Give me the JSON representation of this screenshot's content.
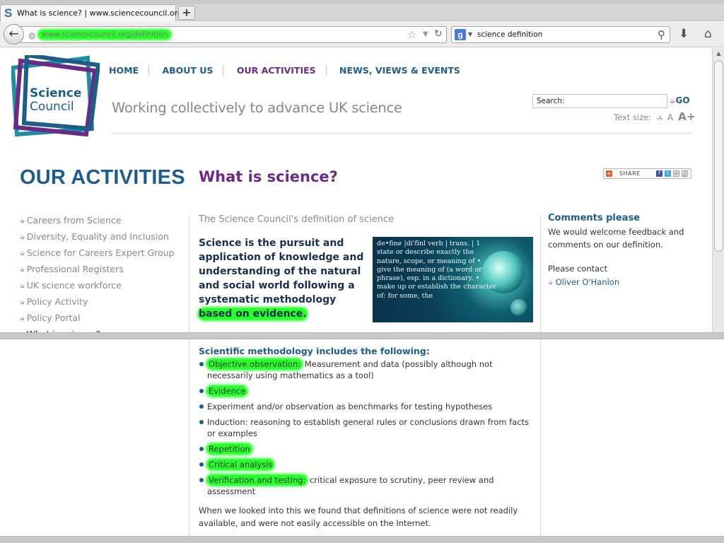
{
  "browser": {
    "tab_title": "What is science? | www.sciencecouncil.org",
    "tab_favicon": "S",
    "new_tab_label": "+",
    "url": "www.sciencecouncil.org/definition",
    "search_query": "science definition",
    "search_engine_letter": "g"
  },
  "site": {
    "logo_line1": "Science",
    "logo_line2": "Council",
    "tagline": "Working collectively to advance UK science",
    "nav": [
      "HOME",
      "ABOUT US",
      "OUR ACTIVITIES",
      "NEWS, VIEWS & EVENTS"
    ],
    "search_value": "Search:",
    "search_go": "GO",
    "text_size_label": "Text size:",
    "text_size_options": [
      "-A",
      "A",
      "A+"
    ],
    "colors": {
      "brand_blue": "#1e5c8a",
      "brand_purple": "#6b2a86",
      "highlight": "#27ff2b"
    }
  },
  "page": {
    "section_title": "OUR ACTIVITIES",
    "title": "What is science?",
    "share_label": "SHARE",
    "subhead": "The Science Council's definition of science",
    "definition": {
      "part1": "Science is the pursuit and application of knowledge and understanding of the natural and social world following a systematic methodology ",
      "highlighted": "based on evidence."
    },
    "dictionary_image_text": "de•fine |di'fīnl verb | trans. | 1 state or describe exactly the nature, scope, or meaning of • give the meaning of (a word or phrase), esp. in a dictionary. • make up or establish the character of: for some, the",
    "methodology_heading": "Scientific methodology includes the following:",
    "methodology": [
      {
        "term": "Objective observation:",
        "desc": " Measurement and data (possibly although not necessarily using mathematics as a tool)",
        "highlight": true
      },
      {
        "term": "Evidence",
        "desc": "",
        "highlight": true
      },
      {
        "term": "",
        "desc": "Experiment and/or observation as benchmarks for testing hypotheses",
        "highlight": false
      },
      {
        "term": "",
        "desc": "Induction: reasoning to establish general rules or conclusions drawn from facts or examples",
        "highlight": false
      },
      {
        "term": "Repetition",
        "desc": "",
        "highlight": true
      },
      {
        "term": "Critical analysis",
        "desc": "",
        "highlight": true
      },
      {
        "term": "Verification and testing:",
        "desc": " critical exposure to scrutiny, peer review and assessment",
        "highlight": true
      }
    ],
    "closing": "When we looked into this we found that definitions of science were not readily available, and were not easily accessible on the Internet."
  },
  "sidebar": {
    "items": [
      "Careers from Science",
      "Diversity, Equality and Inclusion",
      "Science for Careers Expert Group",
      "Professional Registers",
      "UK science workforce",
      "Policy Activity",
      "Policy Portal",
      "What is science?"
    ],
    "current_index": 7
  },
  "comments": {
    "title": "Comments please",
    "body": "We would welcome feedback and comments on our definition.",
    "contact_label": "Please contact",
    "contact_name": "Oliver O'Hanlon"
  },
  "icons": {
    "back": "back-arrow-icon",
    "globe": "globe-icon",
    "bookmark": "star-icon",
    "reload": "reload-icon",
    "search": "magnifier-icon",
    "download": "download-icon",
    "home": "home-icon"
  }
}
